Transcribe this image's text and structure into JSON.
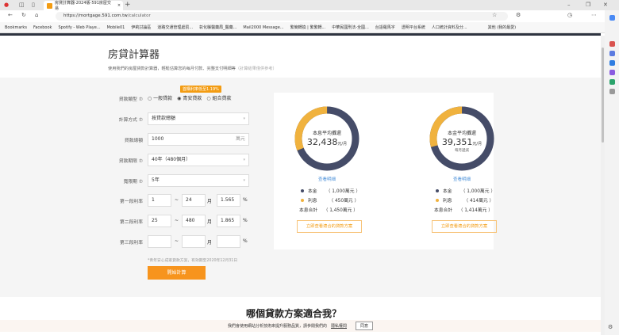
{
  "browser": {
    "tab_title": "房貸計算器-2024版-591房屋交易",
    "url_host": "https://mortgage.591.com.tw",
    "url_path": "/calculator",
    "bookmarks": [
      "Bookmarks",
      "Facebook",
      "Spotify - Web Playe...",
      "Mobile01",
      "伊莉討論區",
      "道路交通管理處罰...",
      "彰化縣醫藥局_醫藥...",
      "Mail2000 Message...",
      "繁簡轉換 | 繁繁轉...",
      "中華民國刑法-全國...",
      "台語羅馬字",
      "透明平台系統",
      "人口統計資料及分...",
      "其他 (我的最愛)"
    ]
  },
  "page": {
    "title": "房貸計算器",
    "subtitle": "使用我們的房屋貸款計算器，輕鬆估算您的每月付款、完整支付明細等",
    "subtitle_note": "（計算結果僅供參考）"
  },
  "form": {
    "promo_tip": "首購利率低至1.19%",
    "loan_type_label": "貸款類型 ⑦",
    "loan_types": [
      "一般貸款",
      "青安貸款",
      "組合貸款"
    ],
    "loan_type_selected": 1,
    "method_label": "計算方式 ⑦",
    "method_value": "按貸款總額",
    "amount_label": "貸款總額",
    "amount_value": "1000",
    "amount_unit": "萬元",
    "term_label": "貸款期限 ⑦",
    "term_value": "40年（480個月）",
    "grace_label": "寬限期 ⑦",
    "grace_value": "5年",
    "rates": [
      {
        "label": "第一段利率",
        "from": "1",
        "to": "24",
        "rate": "1.565"
      },
      {
        "label": "第二段利率",
        "from": "25",
        "to": "480",
        "rate": "1.865"
      },
      {
        "label": "第三段利率",
        "from": "",
        "to": "",
        "rate": ""
      }
    ],
    "tilde": "~",
    "month": "月",
    "percent": "%",
    "note": "*青年安心成家貸款方案，有效期至2020年12月31日",
    "submit": "開始計算"
  },
  "results": [
    {
      "center_label": "本息平均攤還",
      "amount": "32,438",
      "unit": "元/月",
      "sub": "",
      "detail_link": "查看明細",
      "principal_label": "本金",
      "principal": "（ 1,000萬元 ）",
      "interest_label": "利息",
      "interest": "（ 450萬元 ）",
      "total_label": "本息合計",
      "total": "（ 1,450萬元 ）",
      "principal_value": 1000,
      "interest_value": 450,
      "cta": "立即查看適合的貸款方案"
    },
    {
      "center_label": "本金平均攤還",
      "amount": "39,351",
      "unit": "元/月",
      "sub": "每月遞減",
      "detail_link": "查看明細",
      "principal_label": "本金",
      "principal": "（ 1,000萬元 ）",
      "interest_label": "利息",
      "interest": "（ 414萬元 ）",
      "total_label": "本息合計",
      "total": "（ 1,414萬元 ）",
      "principal_value": 1000,
      "interest_value": 414,
      "cta": "立即查看適合的貸款方案"
    }
  ],
  "colors": {
    "principal": "#454c68",
    "interest": "#f0b23e",
    "accent": "#f7941d"
  },
  "section2_title": "哪個貸款方案適合我？",
  "cookie": {
    "text": "我們會使用網站分析技術來提升服務品質，請參閱我們的",
    "link": "隱私權問",
    "button": "同意"
  }
}
